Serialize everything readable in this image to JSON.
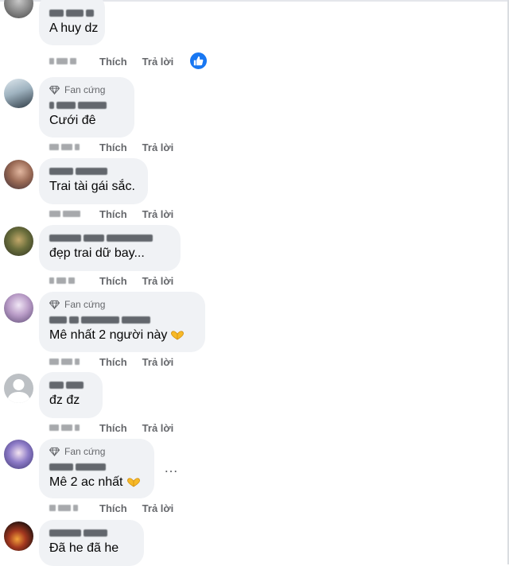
{
  "actions": {
    "like_label": "Thích",
    "reply_label": "Trả lời"
  },
  "badge_label": "Fan cứng",
  "more_options_label": "…",
  "comments": [
    {
      "text": "A huy dz",
      "fan_badge": false,
      "reacted": true,
      "emoji": ""
    },
    {
      "text": "Cưới đê",
      "fan_badge": true,
      "reacted": false,
      "emoji": ""
    },
    {
      "text": "Trai tài gái sắc.",
      "fan_badge": false,
      "reacted": false,
      "emoji": ""
    },
    {
      "text": "đẹp trai dữ bay...",
      "fan_badge": false,
      "reacted": false,
      "emoji": ""
    },
    {
      "text": "Mê nhất 2 người này",
      "fan_badge": true,
      "reacted": false,
      "emoji": "heart-hands"
    },
    {
      "text": "đz đz",
      "fan_badge": false,
      "reacted": false,
      "emoji": ""
    },
    {
      "text": "Mê 2 ac nhất",
      "fan_badge": true,
      "reacted": false,
      "emoji": "heart-hands"
    },
    {
      "text": "Đã he đã he",
      "fan_badge": false,
      "reacted": false,
      "emoji": ""
    }
  ],
  "colors": {
    "bubble": "#f0f2f5",
    "action_text": "#65676b",
    "like_blue": "#1877f2",
    "badge_gold": "#f7b928"
  }
}
